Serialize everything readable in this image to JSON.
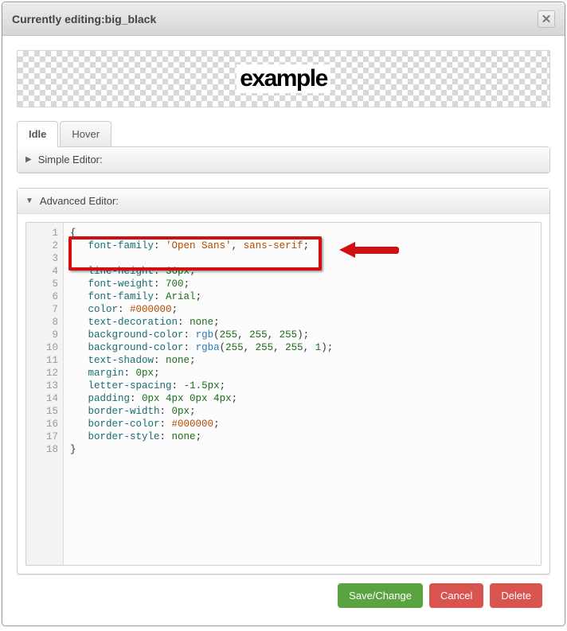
{
  "dialog": {
    "titlePrefix": "Currently editing: ",
    "titleTarget": "big_black"
  },
  "preview": {
    "text": "example"
  },
  "tabs": {
    "idle": "Idle",
    "hover": "Hover"
  },
  "sections": {
    "simple": "Simple Editor:",
    "advanced": "Advanced Editor:"
  },
  "code": {
    "lineNumbers": "1\n2\n3\n4\n5\n6\n7\n8\n9\n10\n11\n12\n13\n14\n15\n16\n17\n18",
    "lines": {
      "l1": "{",
      "l2_prop": "font-family",
      "l2_val1": "'Open Sans'",
      "l2_val2": "sans-serif",
      "l4_prop": "line-height",
      "l4_val": "36px",
      "l5_prop": "font-weight",
      "l5_val": "700",
      "l6_prop": "font-family",
      "l6_val": "Arial",
      "l7_prop": "color",
      "l7_val": "#000000",
      "l8_prop": "text-decoration",
      "l8_val": "none",
      "l9_prop": "background-color",
      "l9_func": "rgb",
      "l9_a": "255",
      "l9_b": "255",
      "l9_c": "255",
      "l10_prop": "background-color",
      "l10_func": "rgba",
      "l10_a": "255",
      "l10_b": "255",
      "l10_c": "255",
      "l10_d": "1",
      "l11_prop": "text-shadow",
      "l11_val": "none",
      "l12_prop": "margin",
      "l12_val": "0px",
      "l13_prop": "letter-spacing",
      "l13_val": "-1.5px",
      "l14_prop": "padding",
      "l14_val": "0px 4px 0px 4px",
      "l15_prop": "border-width",
      "l15_val": "0px",
      "l16_prop": "border-color",
      "l16_val": "#000000",
      "l17_prop": "border-style",
      "l17_val": "none",
      "l18": "}"
    }
  },
  "buttons": {
    "save": "Save/Change",
    "cancel": "Cancel",
    "delete": "Delete"
  }
}
